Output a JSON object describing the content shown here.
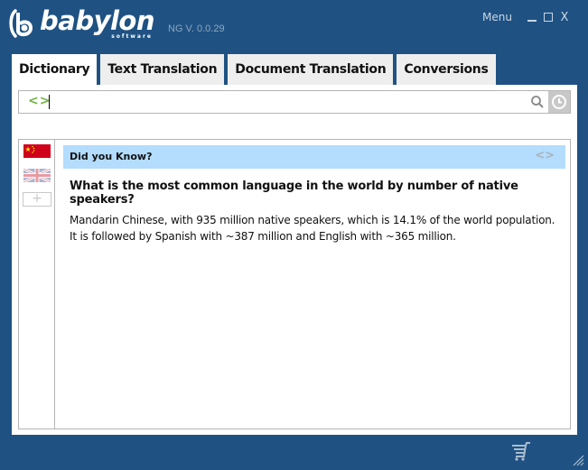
{
  "app": {
    "brand": "babylon",
    "brand_sub": "software",
    "version": "NG V. 0.0.29"
  },
  "window_controls": {
    "menu_label": "Menu",
    "minimize": "minimize-icon",
    "maximize": "maximize-icon",
    "close": "close-icon",
    "close_glyph": "X"
  },
  "tabs": [
    {
      "label": "Dictionary",
      "active": true
    },
    {
      "label": "Text Translation",
      "active": false
    },
    {
      "label": "Document Translation",
      "active": false
    },
    {
      "label": "Conversions",
      "active": false
    }
  ],
  "search": {
    "value": "",
    "placeholder": "",
    "lang_icon_glyph": "<>",
    "search_icon": "search-icon",
    "history_icon": "clock-icon"
  },
  "languages": [
    {
      "name": "Chinese",
      "flag": "china-flag-icon"
    },
    {
      "name": "English (UK)",
      "flag": "uk-flag-icon"
    }
  ],
  "add_language_glyph": "+",
  "did_you_know": {
    "title": "Did you Know?",
    "nav_glyph": "<>",
    "question": "What is the most common language in the world by number of native speakers?",
    "answer": "Mandarin Chinese, with 935 million native speakers, which is 14.1% of the world population. It is followed by Spanish with ~387 million and English with ~365 million."
  },
  "footer": {
    "cart_icon": "shopping-cart-icon",
    "resize_icon": "resize-grip-icon"
  },
  "colors": {
    "background": "#1f5283",
    "tab_inactive": "#eeeeee",
    "accent_green": "#6db33f",
    "dyk_header": "#b3dcfd"
  }
}
